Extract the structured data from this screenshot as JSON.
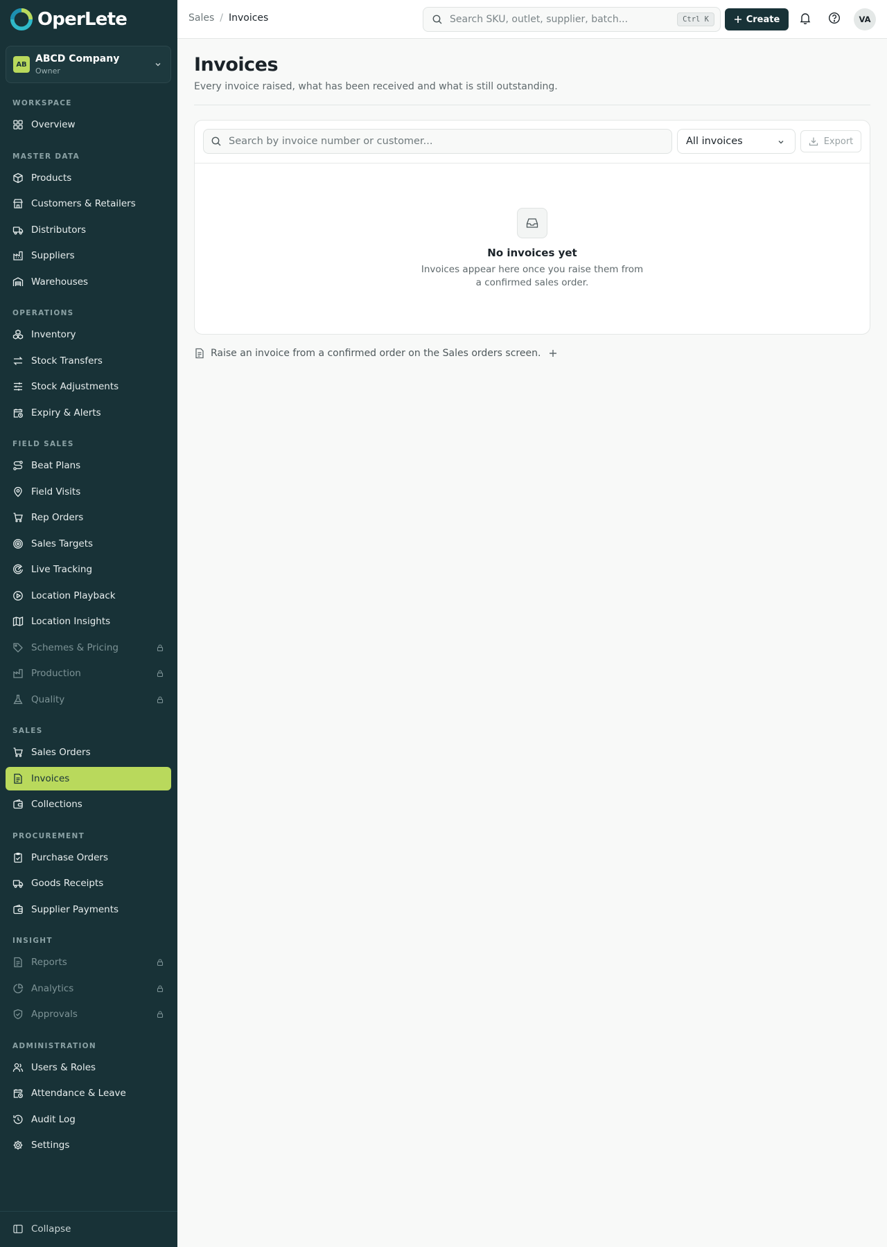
{
  "app": {
    "name": "OperLete"
  },
  "company": {
    "initials": "AB",
    "name": "ABCD Company",
    "role": "Owner"
  },
  "sidebar": {
    "sections": {
      "workspace": "WORKSPACE",
      "master_data": "MASTER DATA",
      "operations": "OPERATIONS",
      "field_sales": "FIELD SALES",
      "sales": "SALES",
      "procurement": "PROCUREMENT",
      "insight": "INSIGHT",
      "administration": "ADMINISTRATION"
    },
    "items": {
      "overview": "Overview",
      "products": "Products",
      "customers": "Customers & Retailers",
      "distributors": "Distributors",
      "suppliers": "Suppliers",
      "warehouses": "Warehouses",
      "inventory": "Inventory",
      "stock_transfers": "Stock Transfers",
      "stock_adjustments": "Stock Adjustments",
      "expiry_alerts": "Expiry & Alerts",
      "beat_plans": "Beat Plans",
      "field_visits": "Field Visits",
      "rep_orders": "Rep Orders",
      "sales_targets": "Sales Targets",
      "live_tracking": "Live Tracking",
      "location_playback": "Location Playback",
      "location_insights": "Location Insights",
      "schemes_pricing": "Schemes & Pricing",
      "production": "Production",
      "quality": "Quality",
      "sales_orders": "Sales Orders",
      "invoices": "Invoices",
      "collections": "Collections",
      "purchase_orders": "Purchase Orders",
      "goods_receipts": "Goods Receipts",
      "supplier_payments": "Supplier Payments",
      "reports": "Reports",
      "analytics": "Analytics",
      "approvals": "Approvals",
      "users_roles": "Users & Roles",
      "attendance_leave": "Attendance & Leave",
      "audit_log": "Audit Log",
      "settings": "Settings"
    },
    "collapse": "Collapse"
  },
  "topbar": {
    "breadcrumb": [
      "Sales",
      "/",
      "Invoices"
    ],
    "search_placeholder": "Search SKU, outlet, supplier, batch...",
    "shortcut": "Ctrl K",
    "create_label": "Create",
    "avatar_initials": "VA"
  },
  "page": {
    "title": "Invoices",
    "subtitle": "Every invoice raised, what has been received and what is still outstanding."
  },
  "filters": {
    "search_placeholder": "Search by invoice number or customer...",
    "status_selected": "All invoices",
    "export_label": "Export"
  },
  "empty_state": {
    "title": "No invoices yet",
    "text": "Invoices appear here once you raise them from a confirmed sales order."
  },
  "hint": "Raise an invoice from a confirmed order on the Sales orders screen.",
  "colors": {
    "sidebar_bg": "#183237",
    "accent": "#b9d95c",
    "primary_button": "#183237",
    "page_bg": "#f8f9f8"
  }
}
